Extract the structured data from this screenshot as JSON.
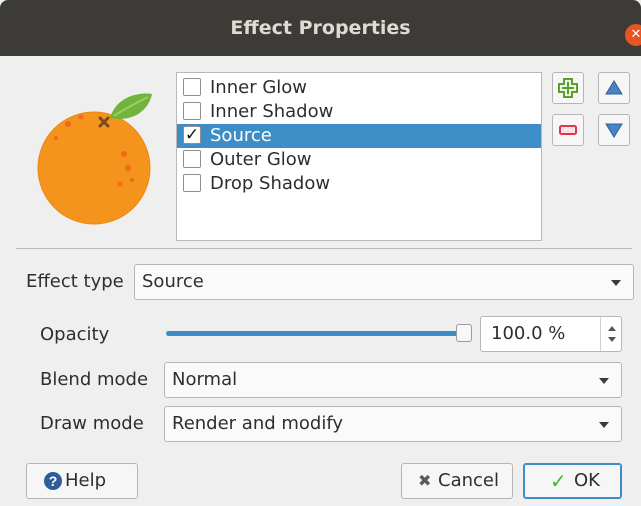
{
  "window": {
    "title": "Effect Properties"
  },
  "effects": [
    {
      "label": "Inner Glow",
      "checked": false,
      "selected": false
    },
    {
      "label": "Inner Shadow",
      "checked": false,
      "selected": false
    },
    {
      "label": "Source",
      "checked": true,
      "selected": true
    },
    {
      "label": "Outer Glow",
      "checked": false,
      "selected": false
    },
    {
      "label": "Drop Shadow",
      "checked": false,
      "selected": false
    }
  ],
  "toolbar": {
    "add_icon": "plus-icon",
    "remove_icon": "minus-icon",
    "up_icon": "arrow-up-icon",
    "down_icon": "arrow-down-icon"
  },
  "form": {
    "effect_type_label": "Effect type",
    "effect_type_value": "Source",
    "opacity_label": "Opacity",
    "opacity_value": "100.0 %",
    "opacity_fraction": 1.0,
    "blend_mode_label": "Blend mode",
    "blend_mode_value": "Normal",
    "draw_mode_label": "Draw mode",
    "draw_mode_value": "Render and modify"
  },
  "buttons": {
    "help": "Help",
    "cancel": "Cancel",
    "ok": "OK"
  },
  "colors": {
    "accent": "#3d8ec7",
    "close": "#e95420",
    "orange": "#f5941d",
    "leaf": "#71b33c",
    "add": "#5aa02c",
    "remove": "#e0344a"
  }
}
